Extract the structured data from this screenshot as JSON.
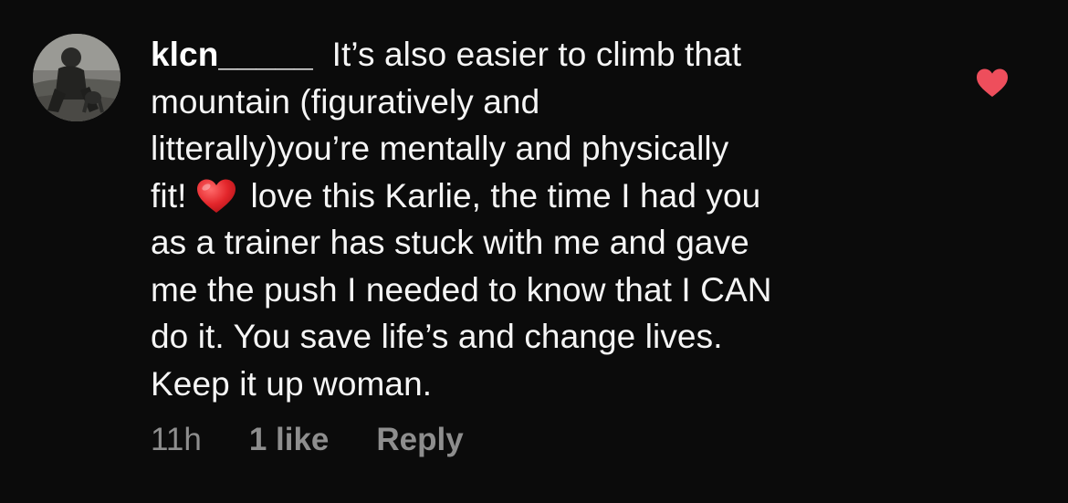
{
  "comment": {
    "username": "klcn_____",
    "lines": [
      "It’s also easier to climb that",
      "mountain (figuratively and",
      "litterally)you’re mentally and physically"
    ],
    "line4_before_emoji": "fit!",
    "line4_after_emoji": "love this Karlie, the time I had you",
    "lines_after": [
      "as a trainer has stuck with me and gave",
      "me the push I needed to know that I CAN",
      "do it. You save life’s and change lives.",
      "Keep it up woman."
    ],
    "emoji": "red-heart-emoji"
  },
  "meta": {
    "time": "11h",
    "likes": "1 like",
    "reply": "Reply"
  },
  "colors": {
    "background": "#0b0b0b",
    "text": "#f5f5f5",
    "muted": "#8e8e8e",
    "like_heart": "#ee4e5c"
  },
  "icons": {
    "like": "heart-icon"
  }
}
